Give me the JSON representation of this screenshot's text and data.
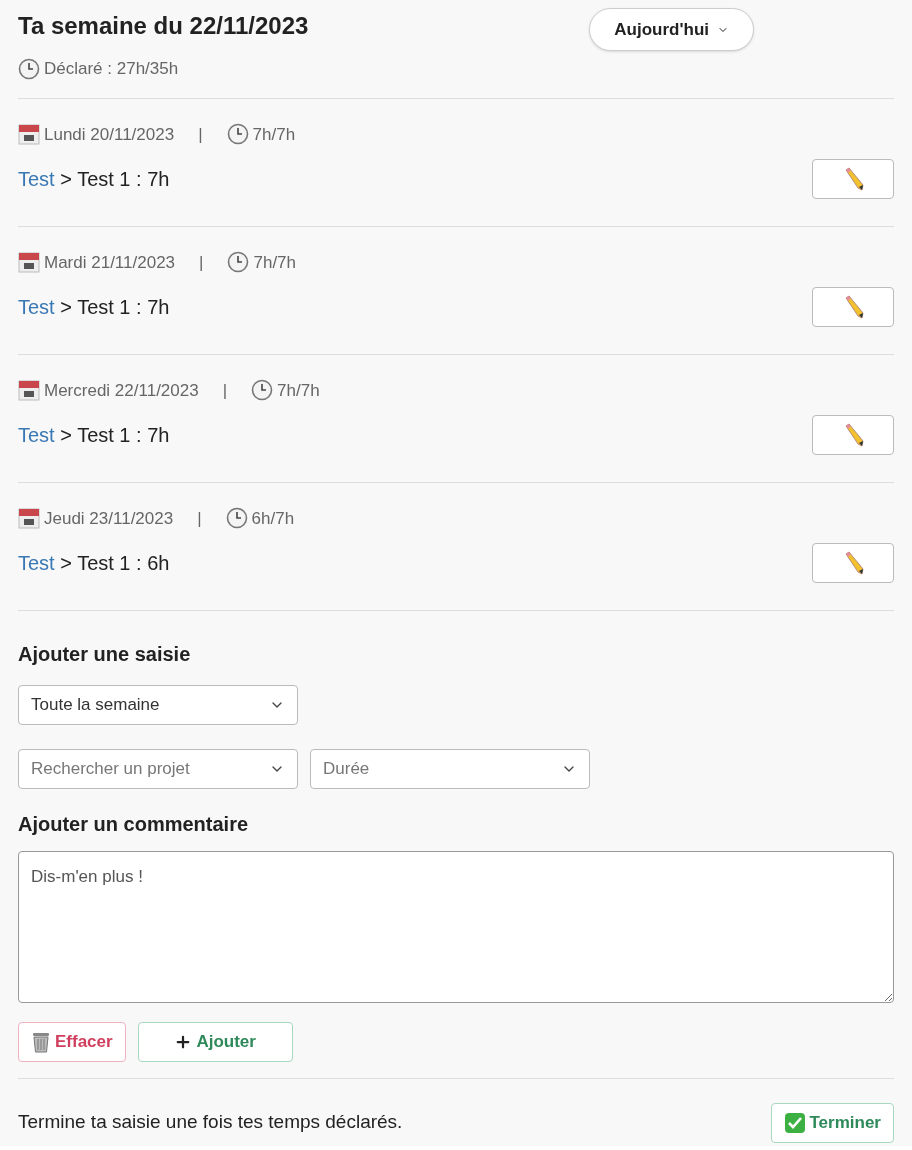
{
  "header": {
    "title": "Ta semaine du 22/11/2023",
    "declared": "Déclaré : 27h/35h",
    "today_button": "Aujourd'hui"
  },
  "days": [
    {
      "date": "Lundi 20/11/2023",
      "separator": "|",
      "hours": "7h/7h",
      "entries": [
        {
          "project": "Test",
          "detail": "> Test 1 : 7h"
        }
      ]
    },
    {
      "date": "Mardi 21/11/2023",
      "separator": "|",
      "hours": "7h/7h",
      "entries": [
        {
          "project": "Test",
          "detail": "> Test 1 : 7h"
        }
      ]
    },
    {
      "date": "Mercredi 22/11/2023",
      "separator": "|",
      "hours": "7h/7h",
      "entries": [
        {
          "project": "Test",
          "detail": "> Test 1 : 7h"
        }
      ]
    },
    {
      "date": "Jeudi 23/11/2023",
      "separator": "|",
      "hours": "6h/7h",
      "entries": [
        {
          "project": "Test",
          "detail": "> Test 1 : 6h"
        }
      ]
    }
  ],
  "form": {
    "title": "Ajouter une saisie",
    "period": {
      "value": "Toute la semaine"
    },
    "project": {
      "placeholder": "Rechercher un projet"
    },
    "duration": {
      "placeholder": "Durée"
    },
    "comment_title": "Ajouter un commentaire",
    "comment": {
      "placeholder": "Dis-m'en plus !"
    },
    "clear_button": "Effacer",
    "add_button": "Ajouter"
  },
  "footer": {
    "text": "Termine ta saisie une fois tes temps déclarés.",
    "finish_button": "Terminer"
  }
}
